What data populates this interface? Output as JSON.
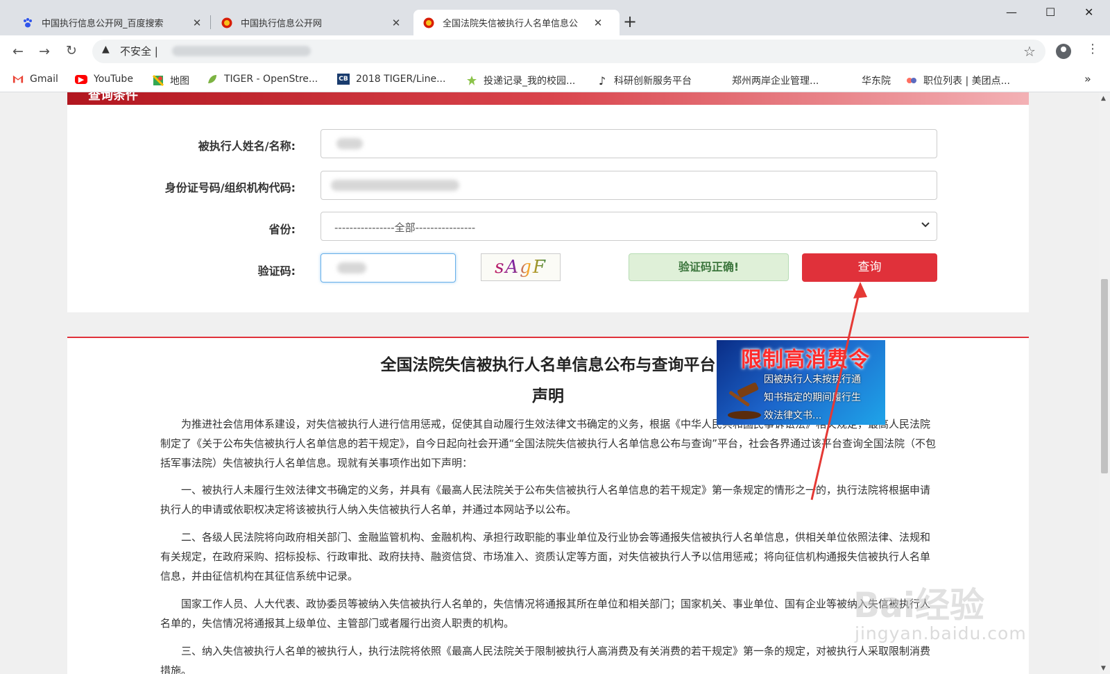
{
  "tabs": [
    {
      "title": "中国执行信息公开网_百度搜索",
      "close": "✕"
    },
    {
      "title": "中国执行信息公开网",
      "close": "✕"
    },
    {
      "title": "全国法院失信被执行人名单信息公",
      "close": "✕"
    }
  ],
  "new_tab": "+",
  "window_controls": {
    "minimize": "—",
    "maximize": "☐",
    "close": "✕"
  },
  "nav": {
    "back": "←",
    "forward": "→",
    "reload": "↻"
  },
  "omnibox": {
    "warning": "▲",
    "security_label": "不安全 |"
  },
  "bookmarks": [
    {
      "label": "Gmail",
      "icon": "gmail-icon"
    },
    {
      "label": "YouTube",
      "icon": "youtube-icon"
    },
    {
      "label": "地图",
      "icon": "maps-icon"
    },
    {
      "label": "TIGER - OpenStre...",
      "icon": "leaf-icon"
    },
    {
      "label": "2018 TIGER/Line...",
      "icon": "cb-icon",
      "icon_text": "CB"
    },
    {
      "label": "投递记录_我的校园...",
      "icon": "star-icon"
    },
    {
      "label": "科研创新服务平台",
      "icon": "note-icon"
    },
    {
      "label": "郑州两岸企业管理...",
      "icon": ""
    },
    {
      "label": "华东院",
      "icon": ""
    },
    {
      "label": "职位列表 | 美团点...",
      "icon": "meituan-icon"
    }
  ],
  "bookmarks_more": "»",
  "form": {
    "header_title": "查询条件",
    "name_label": "被执行人姓名/名称:",
    "id_label": "身份证号码/组织机构代码:",
    "province_label": "省份:",
    "province_value": "----------------全部----------------",
    "captcha_label": "验证码:",
    "captcha_image_text": "sAgF",
    "captcha_status": "验证码正确!",
    "query_button": "查询"
  },
  "document": {
    "title": "全国法院失信被执行人名单信息公布与查询平台",
    "subtitle": "声明",
    "paragraphs": [
      "为推进社会信用体系建设，对失信被执行人进行信用惩戒，促使其自动履行生效法律文书确定的义务，根据《中华人民共和国民事诉讼法》相关规定，最高人民法院制定了《关于公布失信被执行人名单信息的若干规定》，自今日起向社会开通“全国法院失信被执行人名单信息公布与查询”平台，社会各界通过该平台查询全国法院（不包括军事法院）失信被执行人名单信息。现就有关事项作出如下声明：",
      "一、被执行人未履行生效法律文书确定的义务，并具有《最高人民法院关于公布失信被执行人名单信息的若干规定》第一条规定的情形之一的，执行法院将根据申请执行人的申请或依职权决定将该被执行人纳入失信被执行人名单，并通过本网站予以公布。",
      "二、各级人民法院将向政府相关部门、金融监管机构、金融机构、承担行政职能的事业单位及行业协会等通报失信被执行人名单信息，供相关单位依照法律、法规和有关规定，在政府采购、招标投标、行政审批、政府扶持、融资信贷、市场准入、资质认定等方面，对失信被执行人予以信用惩戒；将向征信机构通报失信被执行人名单信息，并由征信机构在其征信系统中记录。",
      "国家工作人员、人大代表、政协委员等被纳入失信被执行人名单的，失信情况将通报其所在单位和相关部门；国家机关、事业单位、国有企业等被纳入失信被执行人名单的，失信情况将通报其上级单位、主管部门或者履行出资人职责的机构。",
      "三、纳入失信被执行人名单的被执行人，执行法院将依照《最高人民法院关于限制被执行人高消费及有关消费的若干规定》第一条的规定，对被执行人采取限制消费措施。"
    ]
  },
  "banner": {
    "title": "限制高消费令",
    "text": "因被执行人未按执行通知书指定的期间履行生效法律文书..."
  },
  "watermark": {
    "main": "Bai经验",
    "sub": "jingyan.baidu.com"
  },
  "colors": {
    "accent_red": "#e0313a",
    "success_green": "#dff0d8",
    "chrome_gray": "#dee1e6"
  }
}
